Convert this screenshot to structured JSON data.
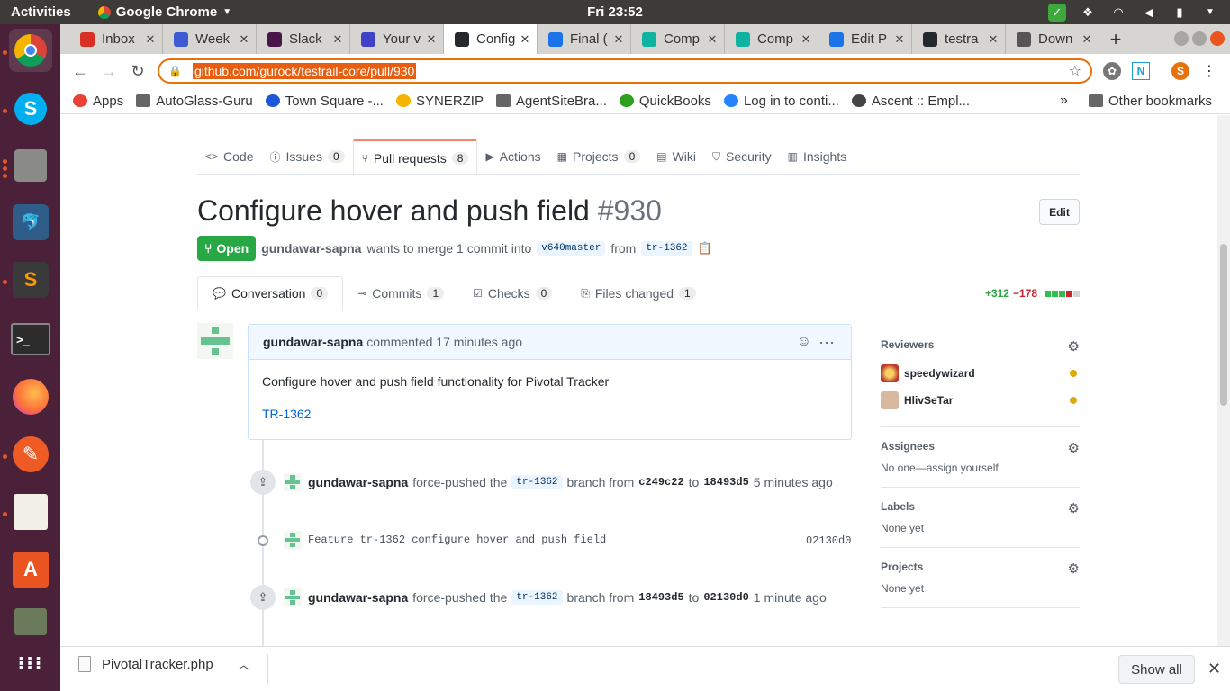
{
  "system": {
    "activities": "Activities",
    "app_name": "Google Chrome",
    "clock": "Fri 23:52"
  },
  "tabs": [
    {
      "label": "Inbox",
      "color": "#d93025",
      "icon": "gmail-icon"
    },
    {
      "label": "Week",
      "color": "#3e5bd4",
      "icon": "w-icon"
    },
    {
      "label": "Slack",
      "color": "#4a154b",
      "icon": "slack-icon"
    },
    {
      "label": "Your v",
      "color": "#4040c8",
      "icon": "jira-icon"
    },
    {
      "label": "Config",
      "color": "#24292e",
      "icon": "github-icon",
      "active": true
    },
    {
      "label": "Final (",
      "color": "#1a73e8",
      "icon": "trello-icon"
    },
    {
      "label": "Comp",
      "color": "#10b2a0",
      "icon": "app-icon"
    },
    {
      "label": "Comp",
      "color": "#10b2a0",
      "icon": "app-icon"
    },
    {
      "label": "Edit P",
      "color": "#1a73e8",
      "icon": "trello-icon"
    },
    {
      "label": "testra",
      "color": "#24292e",
      "icon": "github-icon"
    },
    {
      "label": "Down",
      "color": "#555555",
      "icon": "download-icon"
    }
  ],
  "omnibox": {
    "url": "github.com/gurock/testrail-core/pull/930"
  },
  "profile_letter": "S",
  "bookmarks": [
    {
      "label": "Apps",
      "icon": "apps-grid-icon"
    },
    {
      "label": "AutoGlass-Guru",
      "icon": "folder-icon"
    },
    {
      "label": "Town Square -...",
      "icon": "mattermost-icon"
    },
    {
      "label": "SYNERZIP",
      "icon": "synerzip-icon"
    },
    {
      "label": "AgentSiteBra...",
      "icon": "folder-icon"
    },
    {
      "label": "QuickBooks",
      "icon": "quickbooks-icon"
    },
    {
      "label": "Log in to conti...",
      "icon": "atlassian-icon"
    },
    {
      "label": "Ascent :: Empl...",
      "icon": "ascent-icon"
    }
  ],
  "bookmarks_overflow": "»",
  "other_bookmarks": "Other bookmarks",
  "repo_nav": [
    {
      "label": "Code",
      "count": null,
      "icon": "code-icon"
    },
    {
      "label": "Issues",
      "count": "0",
      "icon": "issue-icon"
    },
    {
      "label": "Pull requests",
      "count": "8",
      "icon": "pull-request-icon",
      "active": true
    },
    {
      "label": "Actions",
      "count": null,
      "icon": "play-icon"
    },
    {
      "label": "Projects",
      "count": "0",
      "icon": "project-icon"
    },
    {
      "label": "Wiki",
      "count": null,
      "icon": "book-icon"
    },
    {
      "label": "Security",
      "count": null,
      "icon": "shield-icon"
    },
    {
      "label": "Insights",
      "count": null,
      "icon": "graph-icon"
    }
  ],
  "pr": {
    "title": "Configure hover and push field",
    "number": "#930",
    "edit": "Edit",
    "state": "Open",
    "author": "gundawar-sapna",
    "merge_text": "wants to merge 1 commit into",
    "base": "v640master",
    "from": "from",
    "head": "tr-1362"
  },
  "pr_tabs": [
    {
      "label": "Conversation",
      "count": "0",
      "active": true
    },
    {
      "label": "Commits",
      "count": "1"
    },
    {
      "label": "Checks",
      "count": "0"
    },
    {
      "label": "Files changed",
      "count": "1"
    }
  ],
  "diffstat": {
    "additions": "+312",
    "deletions": "−178"
  },
  "comment": {
    "author": "gundawar-sapna",
    "action": "commented",
    "time": "17 minutes ago",
    "body": "Configure hover and push field functionality for Pivotal Tracker",
    "link": "TR-1362"
  },
  "timeline": [
    {
      "author": "gundawar-sapna",
      "action": "force-pushed the",
      "branch": "tr-1362",
      "word_from": "branch from",
      "from_sha": "c249c22",
      "word_to": "to",
      "to_sha": "18493d5",
      "time": "5 minutes ago"
    },
    {
      "commit_message": "Feature tr-1362 configure hover and push field",
      "sha": "02130d0"
    },
    {
      "author": "gundawar-sapna",
      "action": "force-pushed the",
      "branch": "tr-1362",
      "word_from": "branch from",
      "from_sha": "18493d5",
      "word_to": "to",
      "to_sha": "02130d0",
      "time": "1 minute ago"
    }
  ],
  "sidebar": {
    "reviewers_title": "Reviewers",
    "reviewers": [
      "speedywizard",
      "HlivSeTar"
    ],
    "assignees_title": "Assignees",
    "assignees_text": "No one—assign yourself",
    "labels_title": "Labels",
    "labels_text": "None yet",
    "projects_title": "Projects",
    "projects_text": "None yet"
  },
  "download": {
    "filename": "PivotalTracker.php",
    "show_all": "Show all"
  }
}
